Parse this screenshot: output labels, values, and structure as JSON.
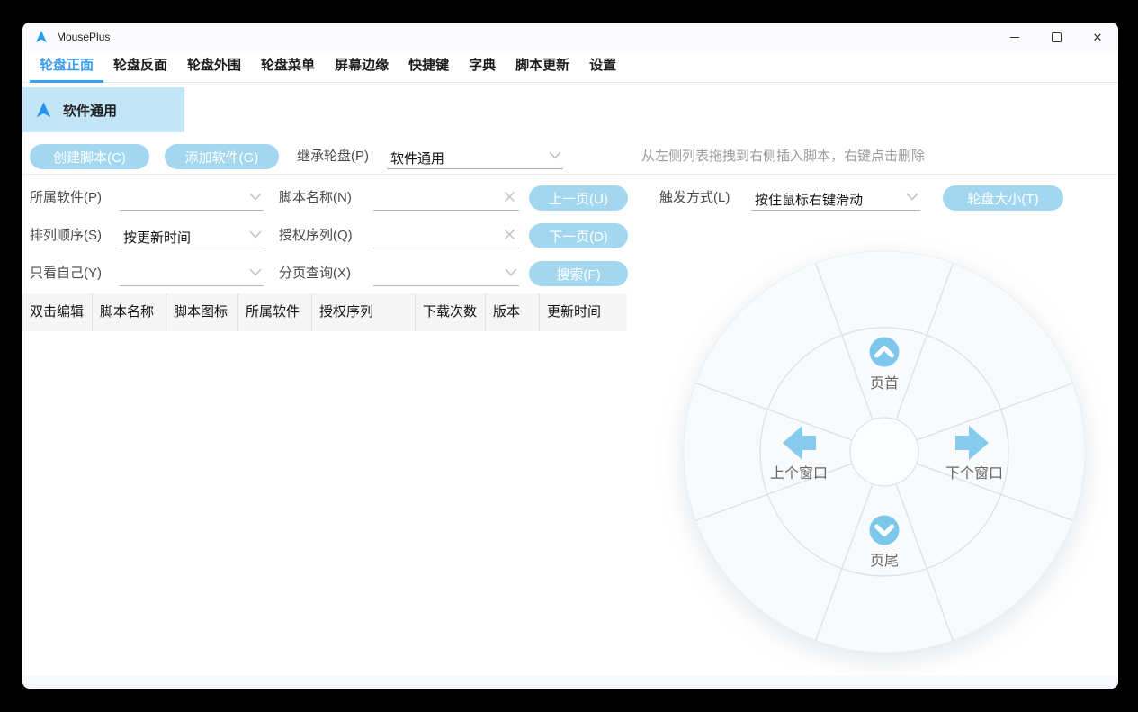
{
  "window": {
    "title": "MousePlus",
    "controls": {
      "minimize": "minimize",
      "maximize": "maximize",
      "close": "close"
    }
  },
  "tabs": [
    {
      "label": "轮盘正面",
      "active": true
    },
    {
      "label": "轮盘反面",
      "active": false
    },
    {
      "label": "轮盘外围",
      "active": false
    },
    {
      "label": "轮盘菜单",
      "active": false
    },
    {
      "label": "屏幕边缘",
      "active": false
    },
    {
      "label": "快捷键",
      "active": false
    },
    {
      "label": "字典",
      "active": false
    },
    {
      "label": "脚本更新",
      "active": false
    },
    {
      "label": "设置",
      "active": false
    }
  ],
  "wheel_card": {
    "label": "软件通用"
  },
  "toolbar": {
    "create_script_button": "创建脚本(C)",
    "add_software_button": "添加软件(G)",
    "inherit_label": "继承轮盘(P)",
    "inherit_value": "软件通用",
    "hint": "从左侧列表拖拽到右侧插入脚本，右键点击删除"
  },
  "filters": {
    "owner_label": "所属软件(P)",
    "owner_value": "",
    "script_name_label": "脚本名称(N)",
    "script_name_value": "",
    "prev_button": "上一页(U)",
    "sort_label": "排列顺序(S)",
    "sort_value": "按更新时间",
    "license_label": "授权序列(Q)",
    "license_value": "",
    "next_button": "下一页(D)",
    "only_mine_label": "只看自己(Y)",
    "only_mine_value": "",
    "paging_label": "分页查询(X)",
    "paging_value": "",
    "search_button": "搜索(F)",
    "trigger_label": "触发方式(L)",
    "trigger_value": "按住鼠标右键滑动",
    "wheel_size_button": "轮盘大小(T)"
  },
  "table": {
    "headers": [
      "双击编辑",
      "脚本名称",
      "脚本图标",
      "所属软件",
      "授权序列",
      "下载次数",
      "版本",
      "更新时间"
    ]
  },
  "wheel": {
    "top": {
      "label": "页首",
      "icon": "chevron-up-circle"
    },
    "left": {
      "label": "上个窗口",
      "icon": "arrow-left"
    },
    "right": {
      "label": "下个窗口",
      "icon": "arrow-right"
    },
    "bottom": {
      "label": "页尾",
      "icon": "chevron-down-circle"
    }
  },
  "colors": {
    "accent_blue": "#3b9ff2",
    "button_blue": "#a3d7f0",
    "card_blue": "#c2e5f8",
    "wheel_icon_blue": "#7cc8ec",
    "wheel_line_gray": "#dcdfe3"
  }
}
